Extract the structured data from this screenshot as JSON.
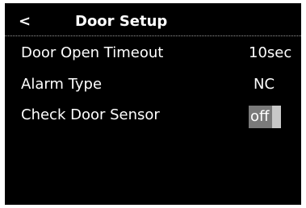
{
  "header": {
    "back_icon": "<",
    "title": "Door Setup"
  },
  "settings": [
    {
      "label": "Door Open Timeout",
      "value": "10sec"
    },
    {
      "label": "Alarm Type",
      "value": "NC"
    },
    {
      "label": "Check Door Sensor",
      "value": "off"
    }
  ],
  "colors": {
    "background": "#000000",
    "text": "#ffffff",
    "highlight": "#7a7a7a",
    "cursor": "#c8c8c8"
  }
}
